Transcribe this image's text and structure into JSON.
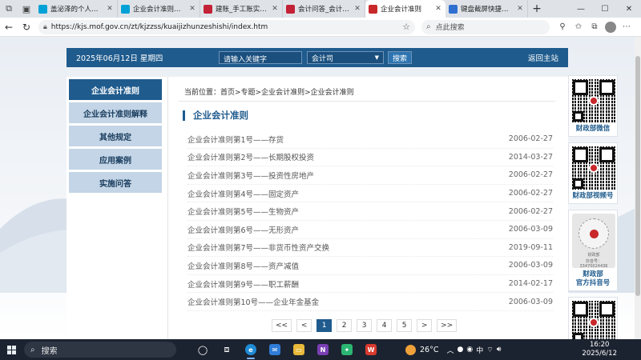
{
  "browser": {
    "tabs": [
      {
        "label": "盖泌泽的个人空间_哔哩",
        "icon": "bilibili-icon",
        "color": "#00a1d6"
      },
      {
        "label": "企业会计准则在哪里",
        "icon": "bilibili-icon",
        "color": "#00a1d6"
      },
      {
        "label": "建账_手工账实务训练",
        "icon": "csdn-icon",
        "color": "#c32136"
      },
      {
        "label": "会计问答_会计问题",
        "icon": "csdn-icon",
        "color": "#c32136"
      },
      {
        "label": "企业会计准则",
        "icon": "emblem-icon",
        "color": "#c8282a",
        "active": true
      },
      {
        "label": "键盘截屏快捷键 - 搜",
        "icon": "search-icon",
        "color": "#2f6fd0"
      }
    ],
    "url": "https://kjs.mof.gov.cn/zt/kjzzss/kuaijizhunzeshishi/index.htm",
    "search_placeholder": "点此搜索"
  },
  "site": {
    "date": "2025年06月12日  星期四",
    "keyword_placeholder": "请输入关键字",
    "scope_select": "会计司",
    "search_button": "搜索",
    "home_link": "返回主站"
  },
  "leftnav": [
    {
      "label": "企业会计准则",
      "active": true
    },
    {
      "label": "企业会计准则解释"
    },
    {
      "label": "其他规定"
    },
    {
      "label": "应用案例"
    },
    {
      "label": "实施问答"
    }
  ],
  "breadcrumb": "当前位置：首页>专题>企业会计准则>企业会计准则",
  "section_title": "企业会计准则",
  "articles": [
    {
      "title": "企业会计准则第1号——存货",
      "date": "2006-02-27"
    },
    {
      "title": "企业会计准则第2号——长期股权投资",
      "date": "2014-03-27"
    },
    {
      "title": "企业会计准则第3号——投资性房地产",
      "date": "2006-02-27"
    },
    {
      "title": "企业会计准则第4号——固定资产",
      "date": "2006-02-27"
    },
    {
      "title": "企业会计准则第5号——生物资产",
      "date": "2006-02-27"
    },
    {
      "title": "企业会计准则第6号——无形资产",
      "date": "2006-03-09"
    },
    {
      "title": "企业会计准则第7号——非货币性资产交换",
      "date": "2019-09-11"
    },
    {
      "title": "企业会计准则第8号——资产减值",
      "date": "2006-03-09"
    },
    {
      "title": "企业会计准则第9号——职工薪酬",
      "date": "2014-02-17"
    },
    {
      "title": "企业会计准则第10号——企业年金基金",
      "date": "2006-03-09"
    }
  ],
  "pagination": {
    "first": "<<",
    "prev": "<",
    "pages": [
      "1",
      "2",
      "3",
      "4",
      "5"
    ],
    "current": "1",
    "next": ">",
    "last": ">>"
  },
  "qr_codes": [
    {
      "label": "财政部微信"
    },
    {
      "label": "财政部视频号"
    },
    {
      "label": "财政部\n官方抖音号",
      "douyin_name": "财政部",
      "douyin_id": "抖音号：33470024436"
    },
    {
      "label": ""
    }
  ],
  "taskbar": {
    "search": "搜索",
    "weather": "26°C",
    "time": "16:20",
    "date": "2025/6/12"
  },
  "colors": {
    "brand_blue": "#1f5b8d",
    "nav_light": "#c3d5e6",
    "emblem_red": "#c8282a"
  }
}
